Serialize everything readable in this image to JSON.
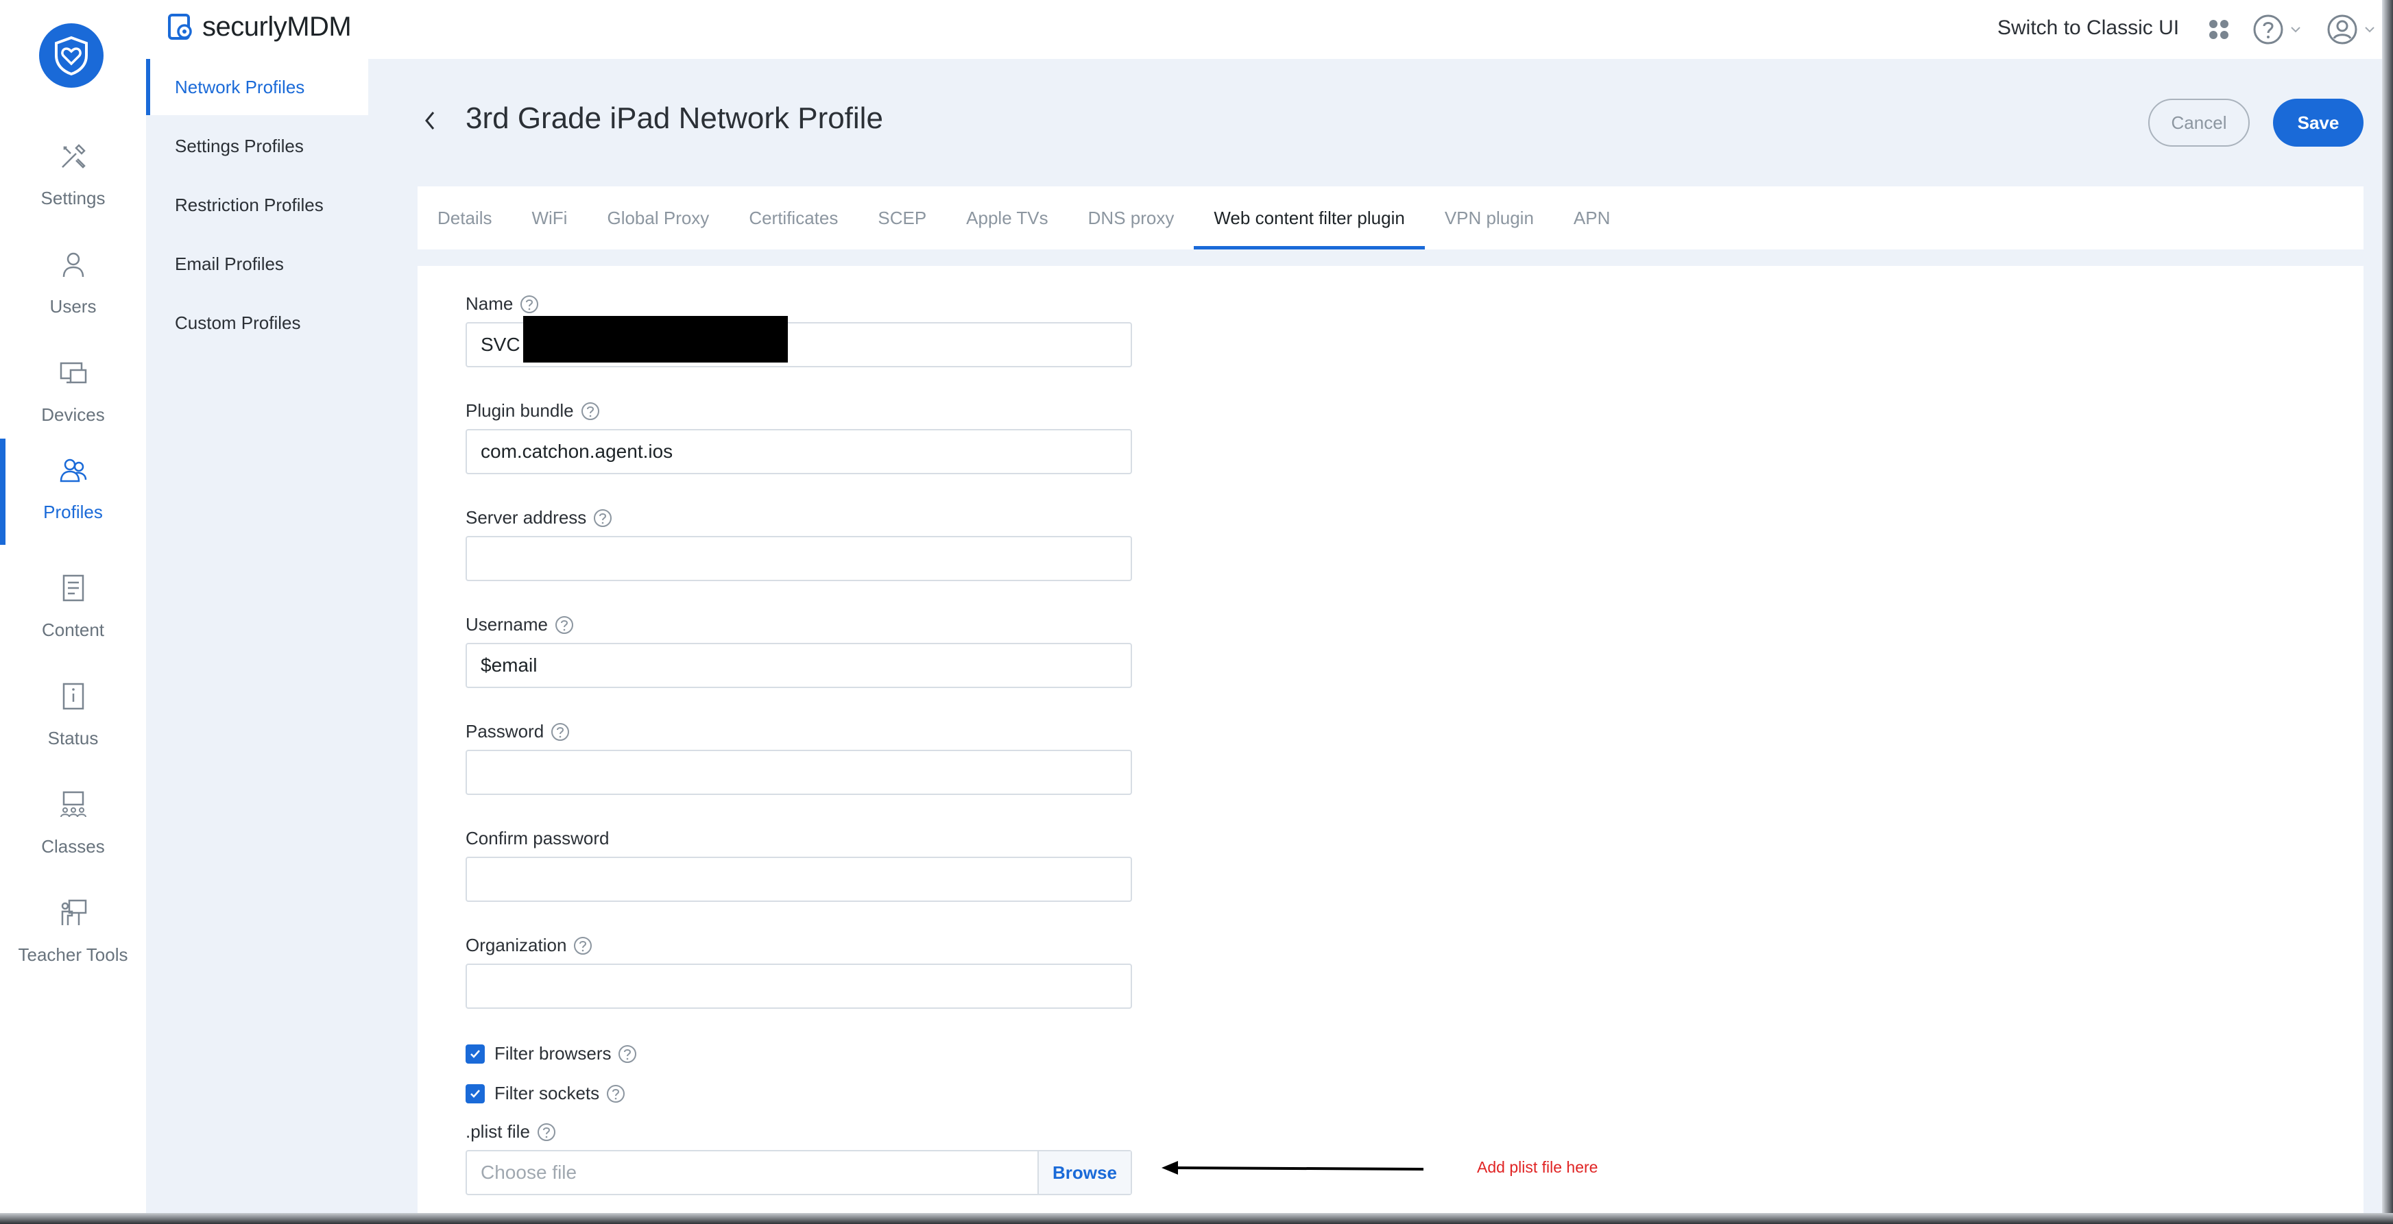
{
  "app": {
    "brand_prefix": "securly",
    "brand_suffix": "MDM",
    "logo_icon": "shield-heart-icon"
  },
  "header": {
    "switch_classic": "Switch to Classic UI",
    "apps_icon": "apps-grid-icon",
    "help_icon": "help-circle-icon",
    "user_icon": "user-circle-icon"
  },
  "rail": {
    "items": [
      {
        "label": "Settings",
        "icon": "tools-icon"
      },
      {
        "label": "Users",
        "icon": "user-icon"
      },
      {
        "label": "Devices",
        "icon": "devices-icon"
      },
      {
        "label": "Profiles",
        "icon": "profiles-icon",
        "active": true
      },
      {
        "label": "Content",
        "icon": "document-icon"
      },
      {
        "label": "Status",
        "icon": "status-icon"
      },
      {
        "label": "Classes",
        "icon": "classes-icon"
      },
      {
        "label": "Teacher Tools",
        "icon": "teacher-tools-icon"
      }
    ]
  },
  "subnav": {
    "items": [
      {
        "label": "Network Profiles",
        "active": true
      },
      {
        "label": "Settings Profiles"
      },
      {
        "label": "Restriction Profiles"
      },
      {
        "label": "Email Profiles"
      },
      {
        "label": "Custom Profiles"
      }
    ]
  },
  "page": {
    "title": "3rd Grade iPad Network Profile",
    "cancel_label": "Cancel",
    "save_label": "Save"
  },
  "tabs": [
    {
      "label": "Details"
    },
    {
      "label": "WiFi"
    },
    {
      "label": "Global Proxy"
    },
    {
      "label": "Certificates"
    },
    {
      "label": "SCEP"
    },
    {
      "label": "Apple TVs"
    },
    {
      "label": "DNS proxy"
    },
    {
      "label": "Web content filter plugin",
      "active": true
    },
    {
      "label": "VPN plugin"
    },
    {
      "label": "APN"
    }
  ],
  "form": {
    "name": {
      "label": "Name",
      "value": "SVC"
    },
    "plugin_bundle": {
      "label": "Plugin bundle",
      "value": "com.catchon.agent.ios"
    },
    "server_address": {
      "label": "Server address",
      "value": ""
    },
    "username": {
      "label": "Username",
      "value": "$email"
    },
    "password": {
      "label": "Password",
      "value": ""
    },
    "confirm_password": {
      "label": "Confirm password",
      "value": ""
    },
    "organization": {
      "label": "Organization",
      "value": ""
    },
    "filter_browsers": {
      "label": "Filter browsers",
      "checked": true
    },
    "filter_sockets": {
      "label": "Filter sockets",
      "checked": true
    },
    "plist_file": {
      "label": ".plist file",
      "placeholder": "Choose file",
      "browse_label": "Browse"
    }
  },
  "annotation": {
    "text": "Add plist file here",
    "color": "#e02424"
  },
  "colors": {
    "accent": "#1a6ad8",
    "background": "#edf2f9"
  }
}
